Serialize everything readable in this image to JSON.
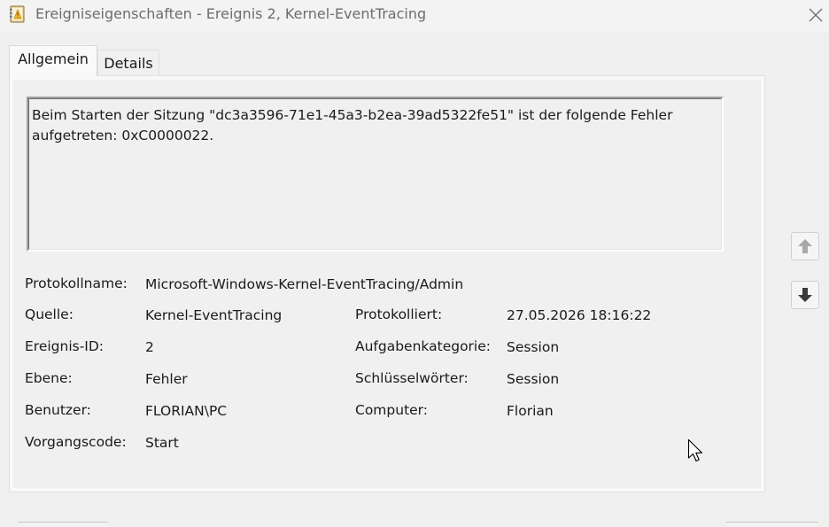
{
  "window": {
    "title": "Ereigniseigenschaften - Ereignis 2, Kernel-EventTracing",
    "app_icon": "event-viewer-icon",
    "close_icon": "close-icon"
  },
  "tabs": [
    {
      "label": "Allgemein",
      "active": true
    },
    {
      "label": "Details",
      "active": false
    }
  ],
  "message": "Beim Starten der Sitzung \"dc3a3596-71e1-45a3-b2ea-39ad5322fe51\" ist der folgende Fehler aufgetreten: 0xC0000022.",
  "fields": {
    "log_name": {
      "label": "Protokollname:",
      "value": "Microsoft-Windows-Kernel-EventTracing/Admin"
    },
    "source": {
      "label": "Quelle:",
      "value": "Kernel-EventTracing"
    },
    "logged": {
      "label": "Protokolliert:",
      "value": "27.05.2026 18:16:22"
    },
    "event_id": {
      "label": "Ereignis-ID:",
      "value": "2"
    },
    "task_category": {
      "label": "Aufgabenkategorie:",
      "value": "Session"
    },
    "level": {
      "label": "Ebene:",
      "value": "Fehler"
    },
    "keywords": {
      "label": "Schlüsselwörter:",
      "value": "Session"
    },
    "user": {
      "label": "Benutzer:",
      "value": "FLORIAN\\PC"
    },
    "computer": {
      "label": "Computer:",
      "value": "Florian"
    },
    "opcode": {
      "label": "Vorgangscode:",
      "value": "Start"
    }
  },
  "nav": {
    "up_icon": "arrow-up-icon",
    "down_icon": "arrow-down-icon"
  },
  "colors": {
    "background": "#f0f0f0",
    "title_text": "#6d6d6d"
  }
}
